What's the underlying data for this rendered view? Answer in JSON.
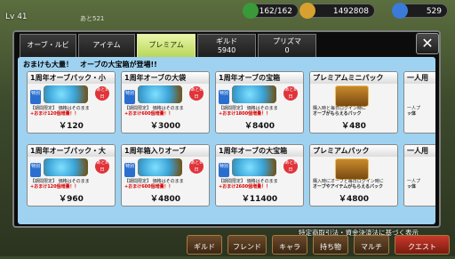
{
  "hud": {
    "level": "Lv 41",
    "level_sub": "あと521",
    "stamina": "162/162",
    "gold": "1492808",
    "gems": "529"
  },
  "tabs": [
    {
      "label": "オーブ・ルビ",
      "sub": ""
    },
    {
      "label": "アイテム",
      "sub": ""
    },
    {
      "label": "プレミアム",
      "sub": ""
    },
    {
      "label": "ギルド",
      "sub": "5940"
    },
    {
      "label": "プリズマ",
      "sub": "0"
    }
  ],
  "close_label": "✕",
  "banner": "おまけも大量！　オーブの大宝箱が登場!!",
  "cards": [
    {
      "title": "1周年オーブパック・小",
      "desc": "【期間限定】 価格はそのまま",
      "bonus": "+おまけ120個増量！！",
      "price": "￥120",
      "badge": "あと8日",
      "tag": "特別",
      "chest": false
    },
    {
      "title": "1周年オーブの大袋",
      "desc": "【期間限定】 価格はそのまま",
      "bonus": "+おまけ600個増量！！",
      "price": "￥3000",
      "badge": "あと8日",
      "tag": "特別",
      "chest": false
    },
    {
      "title": "1周年オーブの宝箱",
      "desc": "【期間限定】 価格はそのまま",
      "bonus": "+おまけ1800個増量！！",
      "price": "￥8400",
      "badge": "あと8日",
      "tag": "特別",
      "chest": false
    },
    {
      "title": "プレミアムミニパック",
      "desc": "購入時と毎日ログイン時に",
      "bonus": "オーブがもらえるパック",
      "price": "￥480",
      "badge": "",
      "tag": "",
      "chest": true
    },
    {
      "title": "一人用",
      "desc": "一人プ",
      "bonus": "ッ体",
      "price": "",
      "badge": "",
      "tag": "",
      "chest": false
    },
    {
      "title": "1周年オーブパック・大",
      "desc": "【期間限定】 価格はそのまま",
      "bonus": "+おまけ120個増量！！",
      "price": "￥960",
      "badge": "あと8日",
      "tag": "特別",
      "chest": false
    },
    {
      "title": "1周年箱入りオーブ",
      "desc": "【期間限定】 価格はそのまま",
      "bonus": "+おまけ600個増量！！",
      "price": "￥4800",
      "badge": "あと8日",
      "tag": "特別",
      "chest": false
    },
    {
      "title": "1周年オーブの大宝箱",
      "desc": "【期間限定】 価格はそのまま",
      "bonus": "+おまけ2600個増量！！",
      "price": "￥11400",
      "badge": "あと8日",
      "tag": "特別",
      "chest": false
    },
    {
      "title": "プレミアムパック",
      "desc": "購入時にオーブと毎日ログイン時に",
      "bonus": "オーブやアイテムがもらえるパック",
      "price": "￥4800",
      "badge": "",
      "tag": "",
      "chest": true
    },
    {
      "title": "一人用",
      "desc": "一人プ",
      "bonus": "ッ体",
      "price": "",
      "badge": "",
      "tag": "",
      "chest": false
    }
  ],
  "notice": "特定商取引法・資金決済法に基づく表示",
  "bottom_nav": [
    "ギルド",
    "フレンド",
    "キャラ",
    "持ち物",
    "マルチ",
    "クエスト"
  ]
}
